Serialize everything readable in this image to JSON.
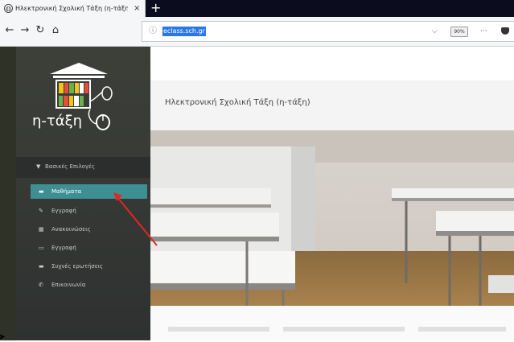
{
  "browser": {
    "tab_title": "Ηλεκτρονική Σχολική Τάξη (η-τάξη)",
    "tab_close": "×",
    "new_tab": "+",
    "url": "eclass.sch.gr",
    "zoom": "90%",
    "more": "···"
  },
  "sidebar": {
    "logo_text": "η-τάξη",
    "section_label": "Βασικές Επιλογές",
    "items": [
      {
        "label": "Μαθήματα",
        "icon": "book-icon",
        "glyph": "▬"
      },
      {
        "label": "Εγγραφή",
        "icon": "pencil-icon",
        "glyph": "✎"
      },
      {
        "label": "Ανακοινώσεις",
        "icon": "grid-icon",
        "glyph": "▦"
      },
      {
        "label": "Εγγραφή",
        "icon": "card-icon",
        "glyph": "▭"
      },
      {
        "label": "Συχνές ερωτήσεις",
        "icon": "chat-icon",
        "glyph": "▬"
      },
      {
        "label": "Επικοινωνία",
        "icon": "phone-icon",
        "glyph": "✆"
      }
    ]
  },
  "main": {
    "page_title": "Ηλεκτρονική Σχολική Τάξη (η-τάξη)"
  },
  "colors": {
    "sidebar_bg": "#35382f",
    "active_item": "#3d8f94",
    "arrow": "#e02828"
  }
}
